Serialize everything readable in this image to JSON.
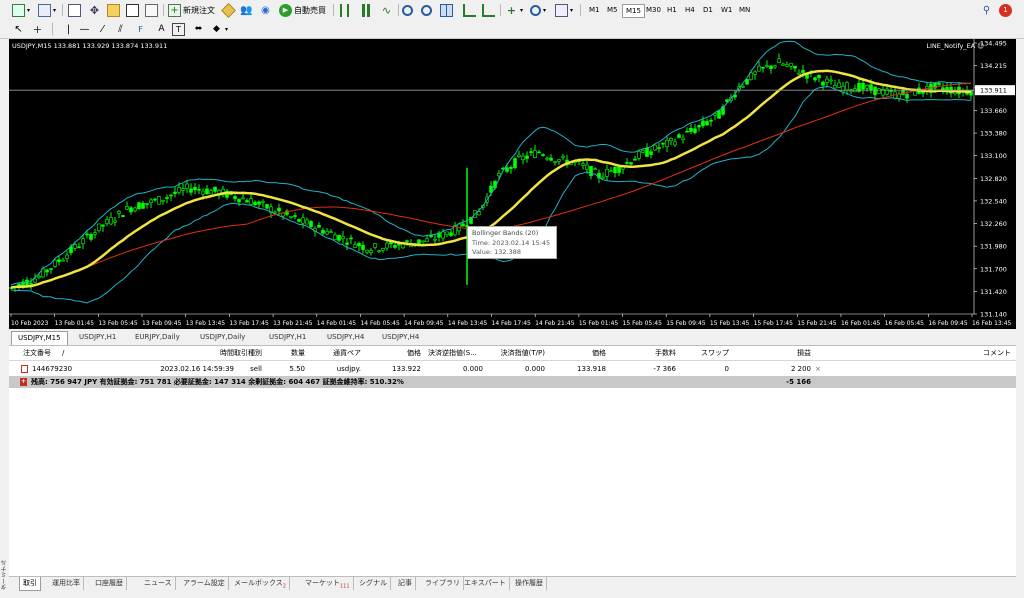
{
  "toolbar": {
    "new_order": "新規注文",
    "auto_trade": "自動売買",
    "timeframes": [
      "M1",
      "M5",
      "M15",
      "M30",
      "H1",
      "H4",
      "D1",
      "W1",
      "MN"
    ],
    "active_timeframe": "M15",
    "notification_count": "1"
  },
  "chart": {
    "title": "USDJPY,M15  133.881 133.929 133.874 133.911",
    "ea_label": "LINE_Notify_EA ☺",
    "price_ticks": [
      "134.495",
      "134.215",
      "133.940",
      "133.660",
      "133.380",
      "133.100",
      "132.820",
      "132.540",
      "132.260",
      "131.980",
      "131.700",
      "131.420",
      "131.140"
    ],
    "current_price": "133.911",
    "time_ticks": [
      "10 Feb 2023",
      "13 Feb 01:45",
      "13 Feb 05:45",
      "13 Feb 09:45",
      "13 Feb 13:45",
      "13 Feb 17:45",
      "13 Feb 21:45",
      "14 Feb 01:45",
      "14 Feb 05:45",
      "14 Feb 09:45",
      "14 Feb 13:45",
      "14 Feb 17:45",
      "14 Feb 21:45",
      "15 Feb 01:45",
      "15 Feb 05:45",
      "15 Feb 09:45",
      "15 Feb 13:45",
      "15 Feb 17:45",
      "15 Feb 21:45",
      "16 Feb 01:45",
      "16 Feb 05:45",
      "16 Feb 09:45",
      "16 Feb 13:45"
    ],
    "tooltip": {
      "name": "Bollinger Bands (20)",
      "time": "Time: 2023.02.14 15:45",
      "value": "Value: 132.388"
    },
    "colors": {
      "candle": "#00ff00",
      "bands": "#20b2c8",
      "ma": "#f0e442",
      "ma2": "#e03010",
      "bg": "#000000"
    }
  },
  "chart_tabs": [
    "USDJPY,M15",
    "USDJPY,H1",
    "EURJPY,Daily",
    "USDJPY,Daily",
    "USDJPY,H1",
    "USDJPY,H4",
    "USDJPY,H4"
  ],
  "active_chart_tab": "USDJPY,M15",
  "terminal": {
    "headers": {
      "order": "注文番号",
      "sort": "/",
      "time": "時間",
      "type": "取引種別",
      "volume": "数量",
      "symbol": "通貨ペア",
      "price": "価格",
      "sl": "決済逆指値(S...",
      "tp": "決済指値(T/P)",
      "price2": "価格",
      "commission": "手数料",
      "swap": "スワップ",
      "profit": "損益",
      "comment": "コメント"
    },
    "order_row": {
      "order": "144679230",
      "time": "2023.02.16 14:59:39",
      "type": "sell",
      "volume": "5.50",
      "symbol": "usdjpy.",
      "price": "133.922",
      "sl": "0.000",
      "tp": "0.000",
      "price2": "133.918",
      "commission": "-7 366",
      "swap": "0",
      "profit": "2 200",
      "close": "×"
    },
    "balance_row": {
      "text": "残高: 756 947 JPY  有効証拠金: 751 781  必要証拠金: 147 314  余剰証拠金: 604 467  証拠金維持率: 510.32%",
      "profit": "-5 166"
    }
  },
  "bottom_tabs": [
    "取引",
    "運用比率",
    "口座履歴",
    "ニュース",
    "アラーム設定",
    "メールボックス",
    "マーケット",
    "シグナル",
    "記事",
    "ライブラリ",
    "エキスパート",
    "操作履歴"
  ],
  "bottom_tab_badges": {
    "mailbox": "2",
    "market": "111"
  },
  "side_label": "ターミナル"
}
